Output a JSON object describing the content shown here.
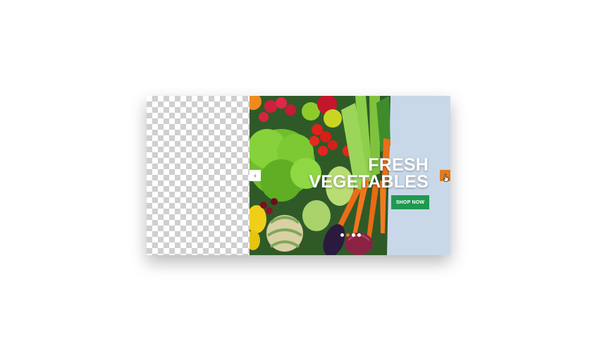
{
  "slider": {
    "headline_line1": "FRESH",
    "headline_line2": "VEGETABLES",
    "cta_label": "SHOP NOW",
    "prev_arrow": "‹",
    "next_arrow": "›",
    "dots": [
      {
        "active": false
      },
      {
        "active": true
      },
      {
        "active": false
      },
      {
        "active": false
      }
    ],
    "colors": {
      "accent": "#e07a22",
      "button": "#1e9a50",
      "background": "#c9d8e9"
    }
  },
  "icons": {
    "prev": "chevron-left-icon",
    "next": "chevron-right-icon",
    "cursor": "hand-pointer-icon"
  }
}
